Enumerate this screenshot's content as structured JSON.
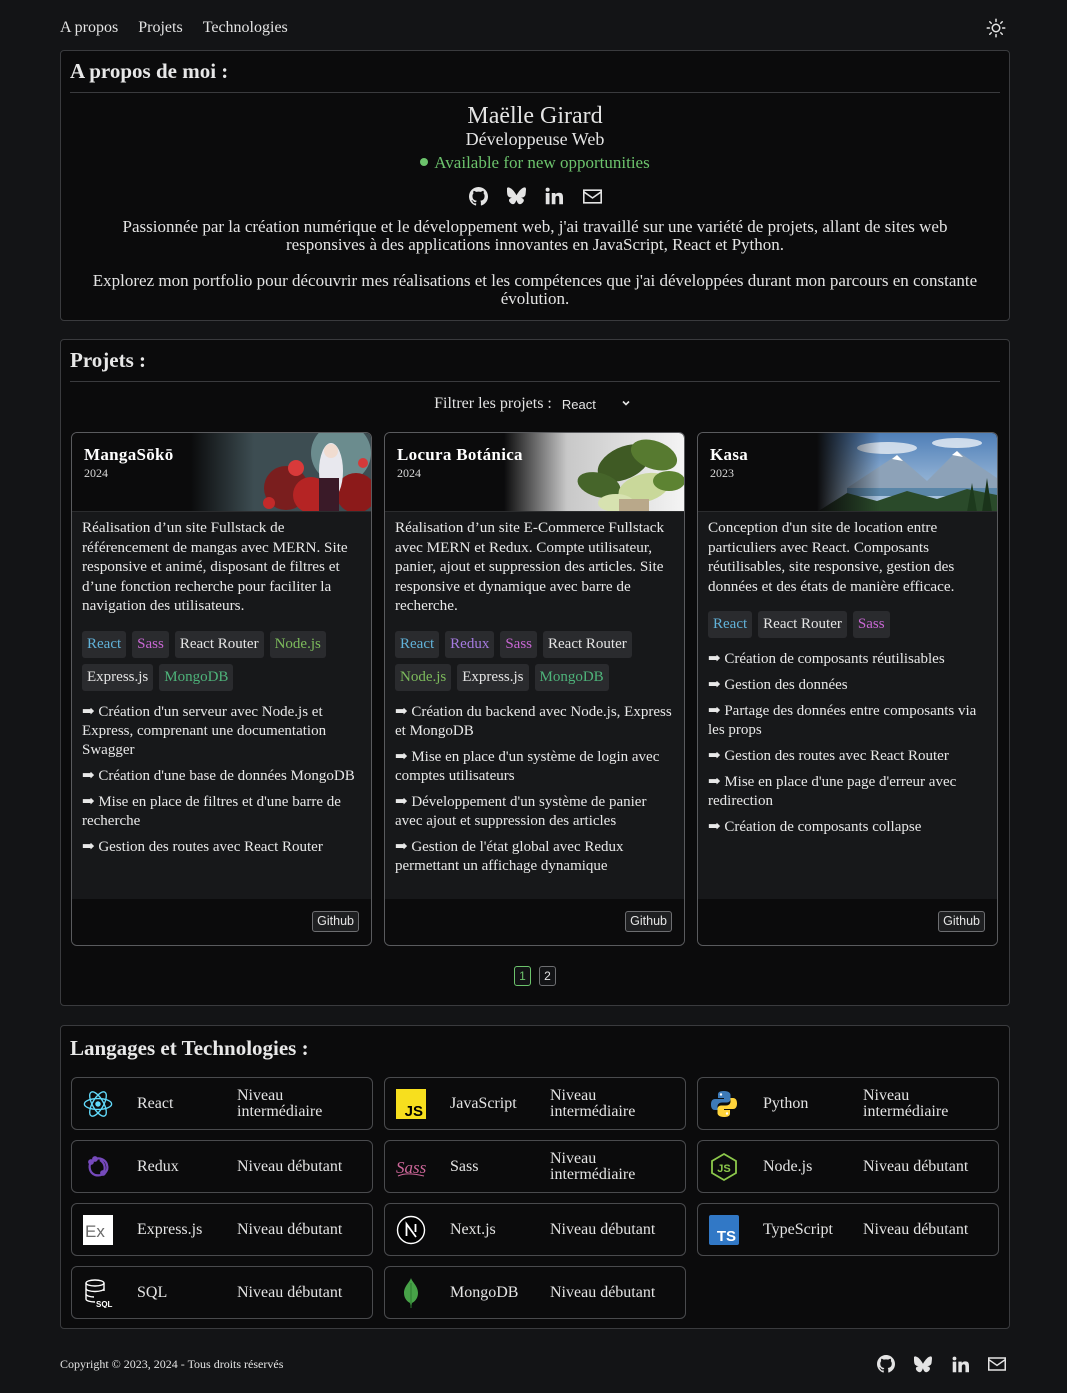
{
  "nav": {
    "items": [
      "A propos",
      "Projets",
      "Technologies"
    ],
    "theme_toggle_icon": "sun-icon"
  },
  "about": {
    "title": "A propos de moi :",
    "name": "Maëlle Girard",
    "role": "Développeuse Web",
    "status": "Available for new opportunities",
    "status_color": "#6cc36c",
    "social_icons": [
      "github-icon",
      "bluesky-icon",
      "linkedin-icon",
      "mail-icon"
    ],
    "paragraph1": "Passionnée par la création numérique et le développement web, j'ai travaillé sur une variété de projets, allant de sites web responsives à des applications innovantes en JavaScript, React et Python.",
    "paragraph2": "Explorez mon portfolio pour découvrir mes réalisations et les compétences que j'ai développées durant mon parcours en constante évolution."
  },
  "projects": {
    "title": "Projets :",
    "filter_label": "Filtrer les projets :",
    "filter_value": "React",
    "github_label": "Github",
    "items": [
      {
        "title": "MangaSōkō",
        "year": "2024",
        "description": "Réalisation d’un site Fullstack de référencement de mangas avec MERN. Site responsive et animé, disposant de filtres et d’une fonction recherche pour faciliter la navigation des utilisateurs.",
        "tags": [
          "React",
          "Sass",
          "React Router",
          "Node.js",
          "Express.js",
          "MongoDB"
        ],
        "features": [
          "➡ Création d'un serveur avec Node.js et Express, comprenant une documentation Swagger",
          "➡ Création d'une base de données MongoDB",
          "➡ Mise en place de filtres et d'une barre de recherche",
          "➡ Gestion des routes avec React Router"
        ]
      },
      {
        "title": "Locura Botánica",
        "year": "2024",
        "description": "Réalisation d’un site E-Commerce Fullstack avec MERN et Redux. Compte utilisateur, panier, ajout et suppression des articles. Site responsive et dynamique avec barre de recherche.",
        "tags": [
          "React",
          "Redux",
          "Sass",
          "React Router",
          "Node.js",
          "Express.js",
          "MongoDB"
        ],
        "features": [
          "➡ Création du backend avec Node.js, Express et MongoDB",
          "➡ Mise en place d'un système de login avec comptes utilisateurs",
          "➡ Développement d'un système de panier avec ajout et suppression des articles",
          "➡ Gestion de l'état global avec Redux permettant un affichage dynamique"
        ]
      },
      {
        "title": "Kasa",
        "year": "2023",
        "description": "Conception d'un site de location entre particuliers avec React. Composants réutilisables, site responsive, gestion des données et des états de manière efficace.",
        "tags": [
          "React",
          "React Router",
          "Sass"
        ],
        "features": [
          "➡ Création de composants réutilisables",
          "➡ Gestion des données",
          "➡ Partage des données entre composants via les props",
          "➡ Gestion des routes avec React Router",
          "➡ Mise en place d'une page d'erreur avec redirection",
          "➡ Création de composants collapse"
        ]
      }
    ],
    "pages": [
      "1",
      "2"
    ],
    "active_page": "1"
  },
  "tech": {
    "title": "Langages et Technologies :",
    "items": [
      {
        "name": "React",
        "level": "Niveau intermédiaire",
        "icon": "react-icon"
      },
      {
        "name": "JavaScript",
        "level": "Niveau intermédiaire",
        "icon": "javascript-icon"
      },
      {
        "name": "Python",
        "level": "Niveau intermédiaire",
        "icon": "python-icon"
      },
      {
        "name": "Redux",
        "level": "Niveau débutant",
        "icon": "redux-icon"
      },
      {
        "name": "Sass",
        "level": "Niveau intermédiaire",
        "icon": "sass-icon"
      },
      {
        "name": "Node.js",
        "level": "Niveau débutant",
        "icon": "nodejs-icon"
      },
      {
        "name": "Express.js",
        "level": "Niveau débutant",
        "icon": "express-icon"
      },
      {
        "name": "Next.js",
        "level": "Niveau débutant",
        "icon": "nextjs-icon"
      },
      {
        "name": "TypeScript",
        "level": "Niveau débutant",
        "icon": "typescript-icon"
      },
      {
        "name": "SQL",
        "level": "Niveau débutant",
        "icon": "sql-icon"
      },
      {
        "name": "MongoDB",
        "level": "Niveau débutant",
        "icon": "mongodb-icon"
      }
    ]
  },
  "footer": {
    "copyright": "Copyright © 2023, 2024 - Tous droits réservés",
    "social_icons": [
      "github-icon",
      "bluesky-icon",
      "linkedin-icon",
      "mail-icon"
    ]
  }
}
